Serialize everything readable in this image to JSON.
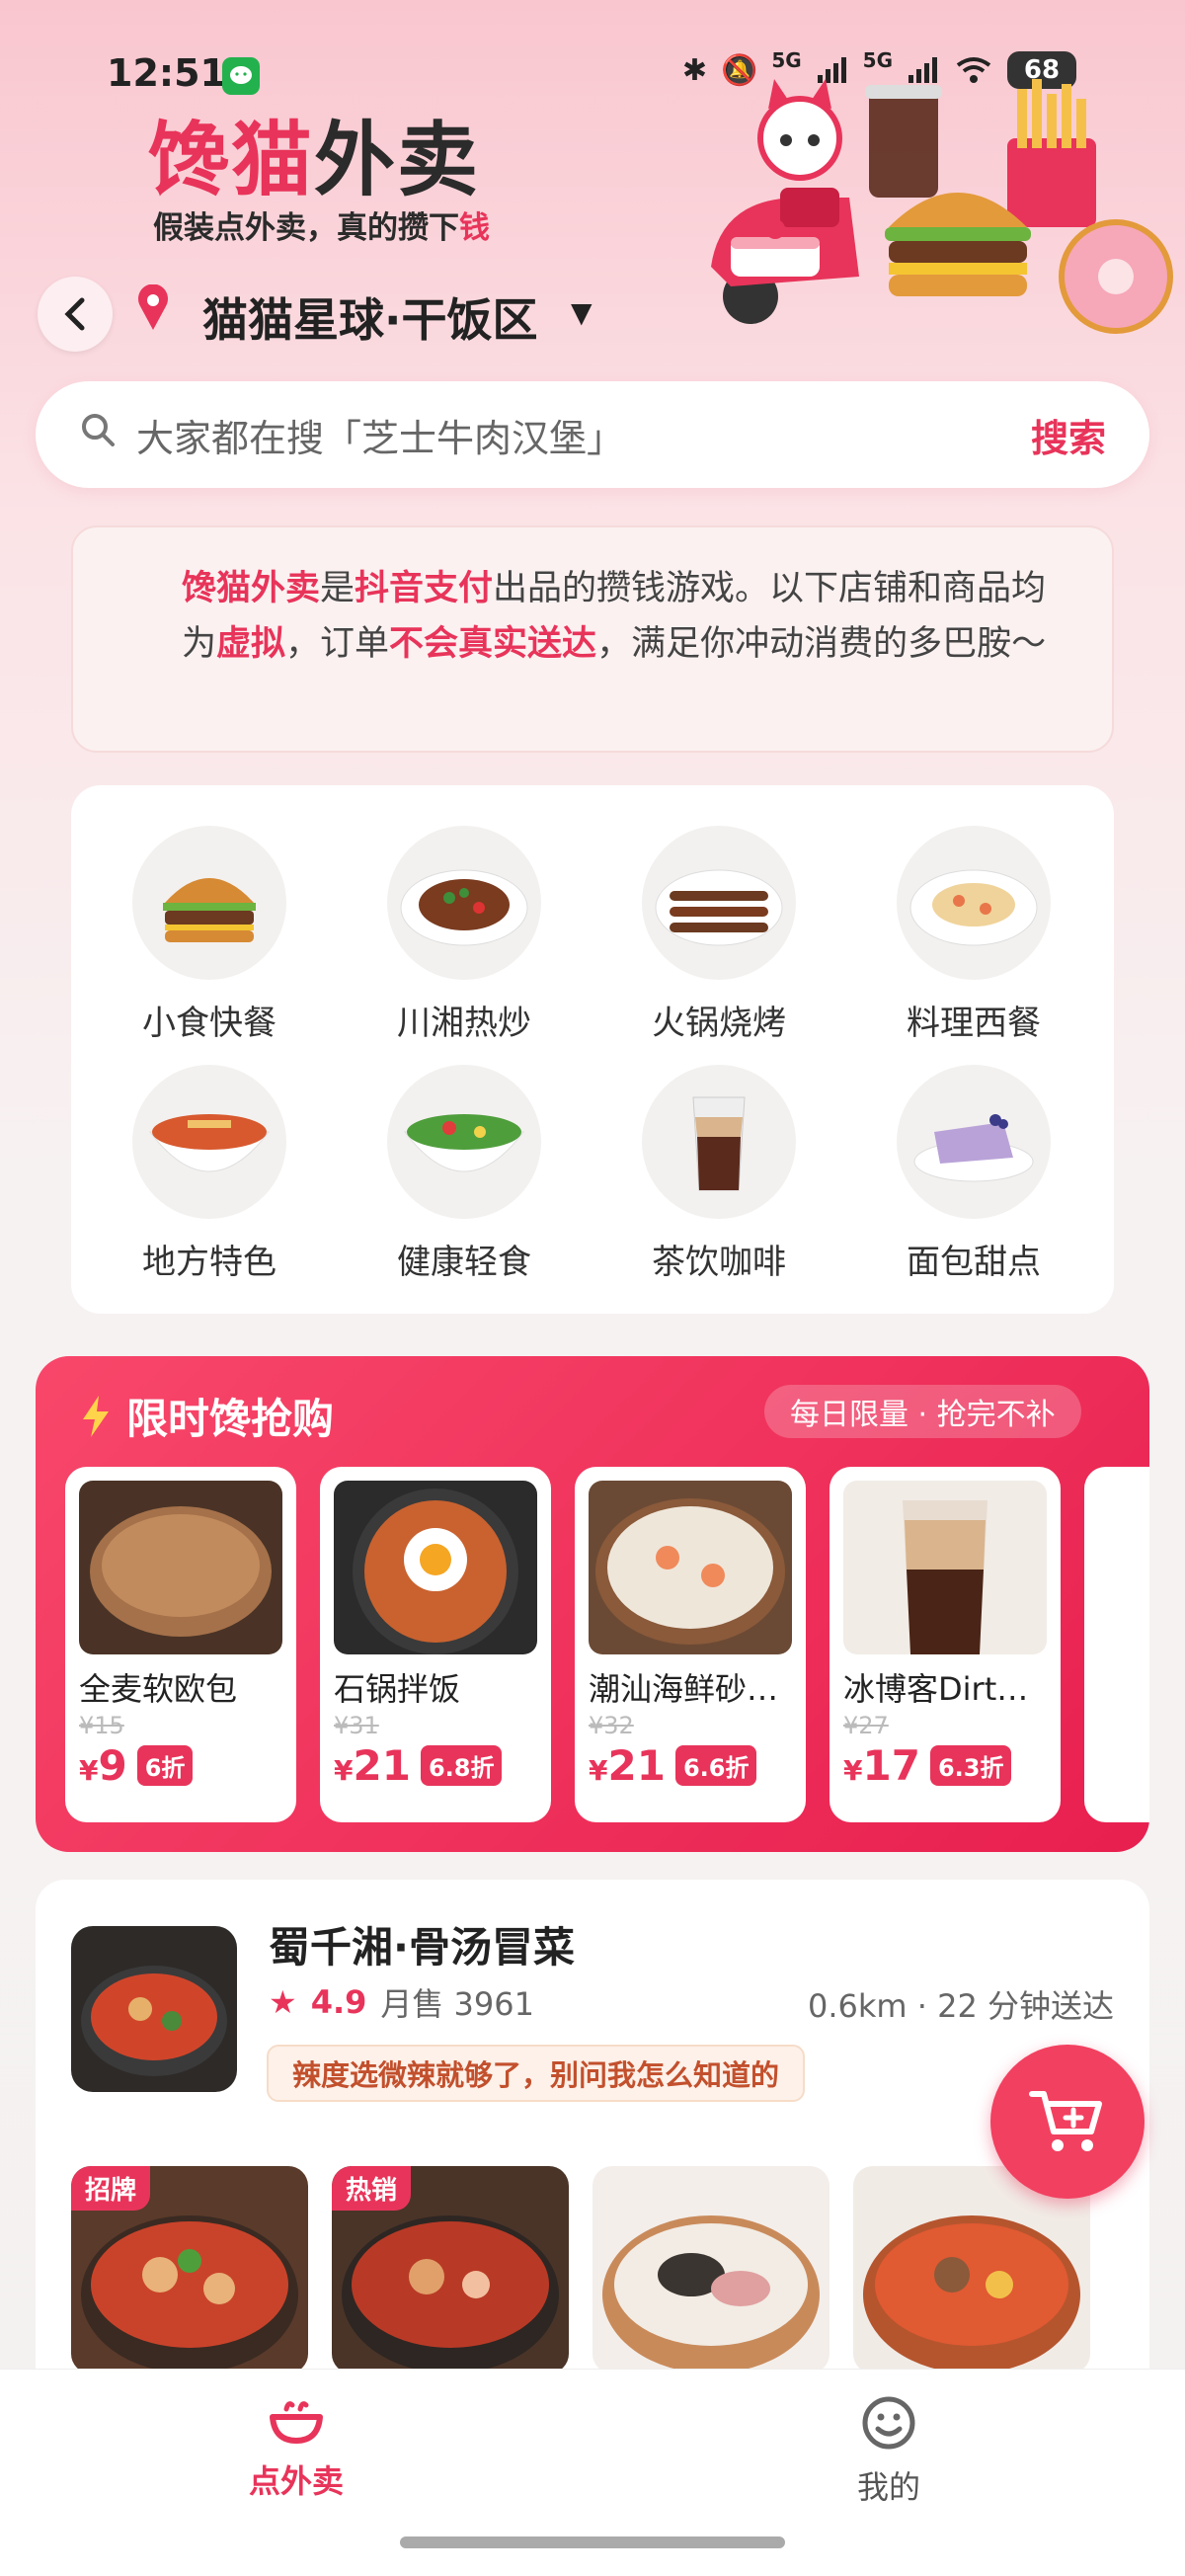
{
  "status_bar": {
    "time": "12:51",
    "wechat_icon": "wechat-icon",
    "network_1": "5G",
    "network_2": "5G",
    "battery": "68"
  },
  "brand": {
    "title_part1": "馋猫",
    "title_part2": "外卖",
    "subtitle_part1": "假装点外卖，真的攒下",
    "subtitle_part2": "钱"
  },
  "location": {
    "name": "猫猫星球·干饭区",
    "caret": "▼"
  },
  "search": {
    "placeholder": "大家都在搜「芝士牛肉汉堡」",
    "button": "搜索"
  },
  "notice": {
    "p1": "馋猫外卖",
    "p2": "是",
    "p3": "抖音支付",
    "p4": "出品的攒钱游戏。以下店铺和商品均为",
    "p5": "虚拟",
    "p6": "，订单",
    "p7": "不会真实送达",
    "p8": "，满足你冲动消费的多巴胺～"
  },
  "categories": [
    {
      "label": "小食快餐"
    },
    {
      "label": "川湘热炒"
    },
    {
      "label": "火锅烧烤"
    },
    {
      "label": "料理西餐"
    },
    {
      "label": "地方特色"
    },
    {
      "label": "健康轻食"
    },
    {
      "label": "茶饮咖啡"
    },
    {
      "label": "面包甜点"
    }
  ],
  "flash_sale": {
    "title": "限时馋抢购",
    "badge": "每日限量 · 抢完不补",
    "items": [
      {
        "name": "全麦软欧包",
        "old_price": "¥15",
        "currency": "¥",
        "price": "9",
        "discount": "6折"
      },
      {
        "name": "石锅拌饭",
        "old_price": "¥31",
        "currency": "¥",
        "price": "21",
        "discount": "6.8折"
      },
      {
        "name": "潮汕海鲜砂…",
        "old_price": "¥32",
        "currency": "¥",
        "price": "21",
        "discount": "6.6折"
      },
      {
        "name": "冰博客Dirt…",
        "old_price": "¥27",
        "currency": "¥",
        "price": "17",
        "discount": "6.3折"
      }
    ]
  },
  "shop": {
    "name": "蜀千湘·骨汤冒菜",
    "star": "★",
    "rating": "4.9",
    "monthly_sales": "月售 3961",
    "distance": "0.6km · 22 分钟送达",
    "tag": "辣度选微辣就够了，别问我怎么知道的",
    "dish_badges": [
      "招牌",
      "热销"
    ]
  },
  "bottom_nav": {
    "order": "点外卖",
    "mine": "我的"
  },
  "colors": {
    "accent": "#e8345a",
    "flash_bg": "#f0305a"
  }
}
